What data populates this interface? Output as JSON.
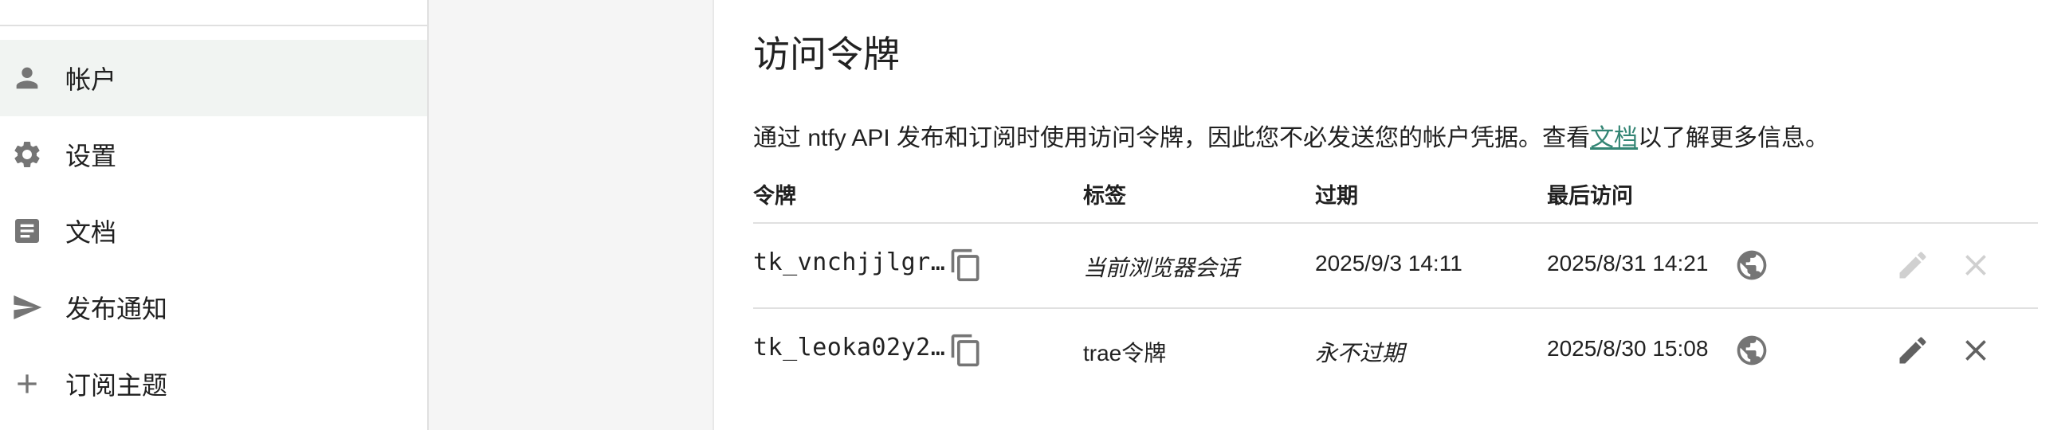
{
  "sidebar": {
    "items": [
      {
        "label": "帐户",
        "icon": "person-icon",
        "selected": true
      },
      {
        "label": "设置",
        "icon": "gear-icon",
        "selected": false
      },
      {
        "label": "文档",
        "icon": "article-icon",
        "selected": false
      },
      {
        "label": "发布通知",
        "icon": "send-icon",
        "selected": false
      },
      {
        "label": "订阅主题",
        "icon": "plus-icon",
        "selected": false
      }
    ]
  },
  "card": {
    "title": "访问令牌",
    "desc_before": "通过 ntfy API 发布和订阅时使用访问令牌，因此您不必发送您的帐户凭据。查看",
    "desc_link": "文档",
    "desc_after": "以了解更多信息。"
  },
  "table": {
    "headers": {
      "token": "令牌",
      "label": "标签",
      "expires": "过期",
      "last_access": "最后访问"
    },
    "rows": [
      {
        "token": "tk_vnchjjlgr…",
        "label": "当前浏览器会话",
        "expires": "2025/9/3 14:11",
        "last_access": "2025/8/31 14:21",
        "editable": false
      },
      {
        "token": "tk_leoka02y2…",
        "label": "trae令牌",
        "expires": "永不过期",
        "last_access": "2025/8/30 15:08",
        "editable": true
      }
    ]
  },
  "colors": {
    "accent": "#338574",
    "selected_bg": "#f1f4f2",
    "gap_bg": "#f5f5f5"
  }
}
